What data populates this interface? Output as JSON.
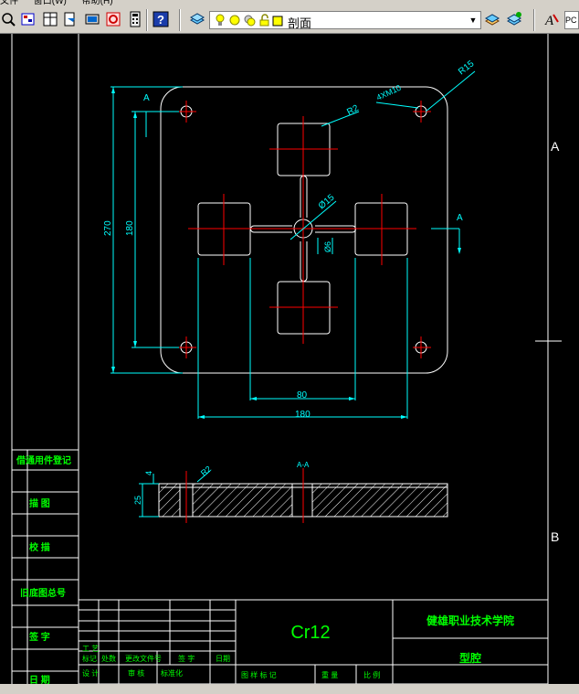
{
  "menu": [
    "文件",
    "窗口(W)",
    "帮助(H)"
  ],
  "toolbar": {
    "layer_name": "剖面",
    "text_style": "PC",
    "icons": [
      "zoom-icon",
      "layer-manager-icon",
      "paste-icon",
      "match-prop-icon",
      "document-icon",
      "calculator-icon",
      "help-icon",
      "layers-icon",
      "lightbulb-icon",
      "sun-icon",
      "lock-icon",
      "color-square-icon",
      "layer-previous-icon",
      "layer-state-icon",
      "text-style-icon"
    ]
  },
  "drawing": {
    "section_label_top": "A",
    "section_label_right": "A",
    "section_title": "A-A",
    "border_label_a": "A",
    "border_label_b": "B",
    "dim_270": "270",
    "dim_180_vertical": "180",
    "dim_80": "80",
    "dim_180_horizontal": "180",
    "dim_r2": "R2",
    "dim_r15": "R15",
    "dim_holes": "4XM10",
    "dim_d15": "Ø15",
    "dim_d6": "Ø6",
    "dim_r2_section": "R2",
    "dim_25": "25",
    "dim_4": "4"
  },
  "left_panel": {
    "row1": "借通用件登记",
    "row2": "描  图",
    "row3": "校  描",
    "row4": "旧底图总号",
    "row5": "签  字",
    "row6": "日  期"
  },
  "title_block": {
    "material": "Cr12",
    "school": "健雄职业技术学院",
    "part_name": "型腔",
    "row_labels": [
      "标记",
      "处数",
      "更改文件号",
      "签  字",
      "日期"
    ],
    "row_labels2": [
      "设  计",
      "标准化"
    ],
    "bottom_labels": [
      "图 样 标 记",
      "重 量",
      "比 例"
    ],
    "row_prefix": "审  核",
    "row_prefix2": "工  艺"
  },
  "colors": {
    "background": "#000000",
    "outline": "#ffffff",
    "dimension": "#00ffff",
    "centerline": "#ff0000",
    "panel_text": "#00ff00",
    "toolbar": "#d4d0c8"
  }
}
